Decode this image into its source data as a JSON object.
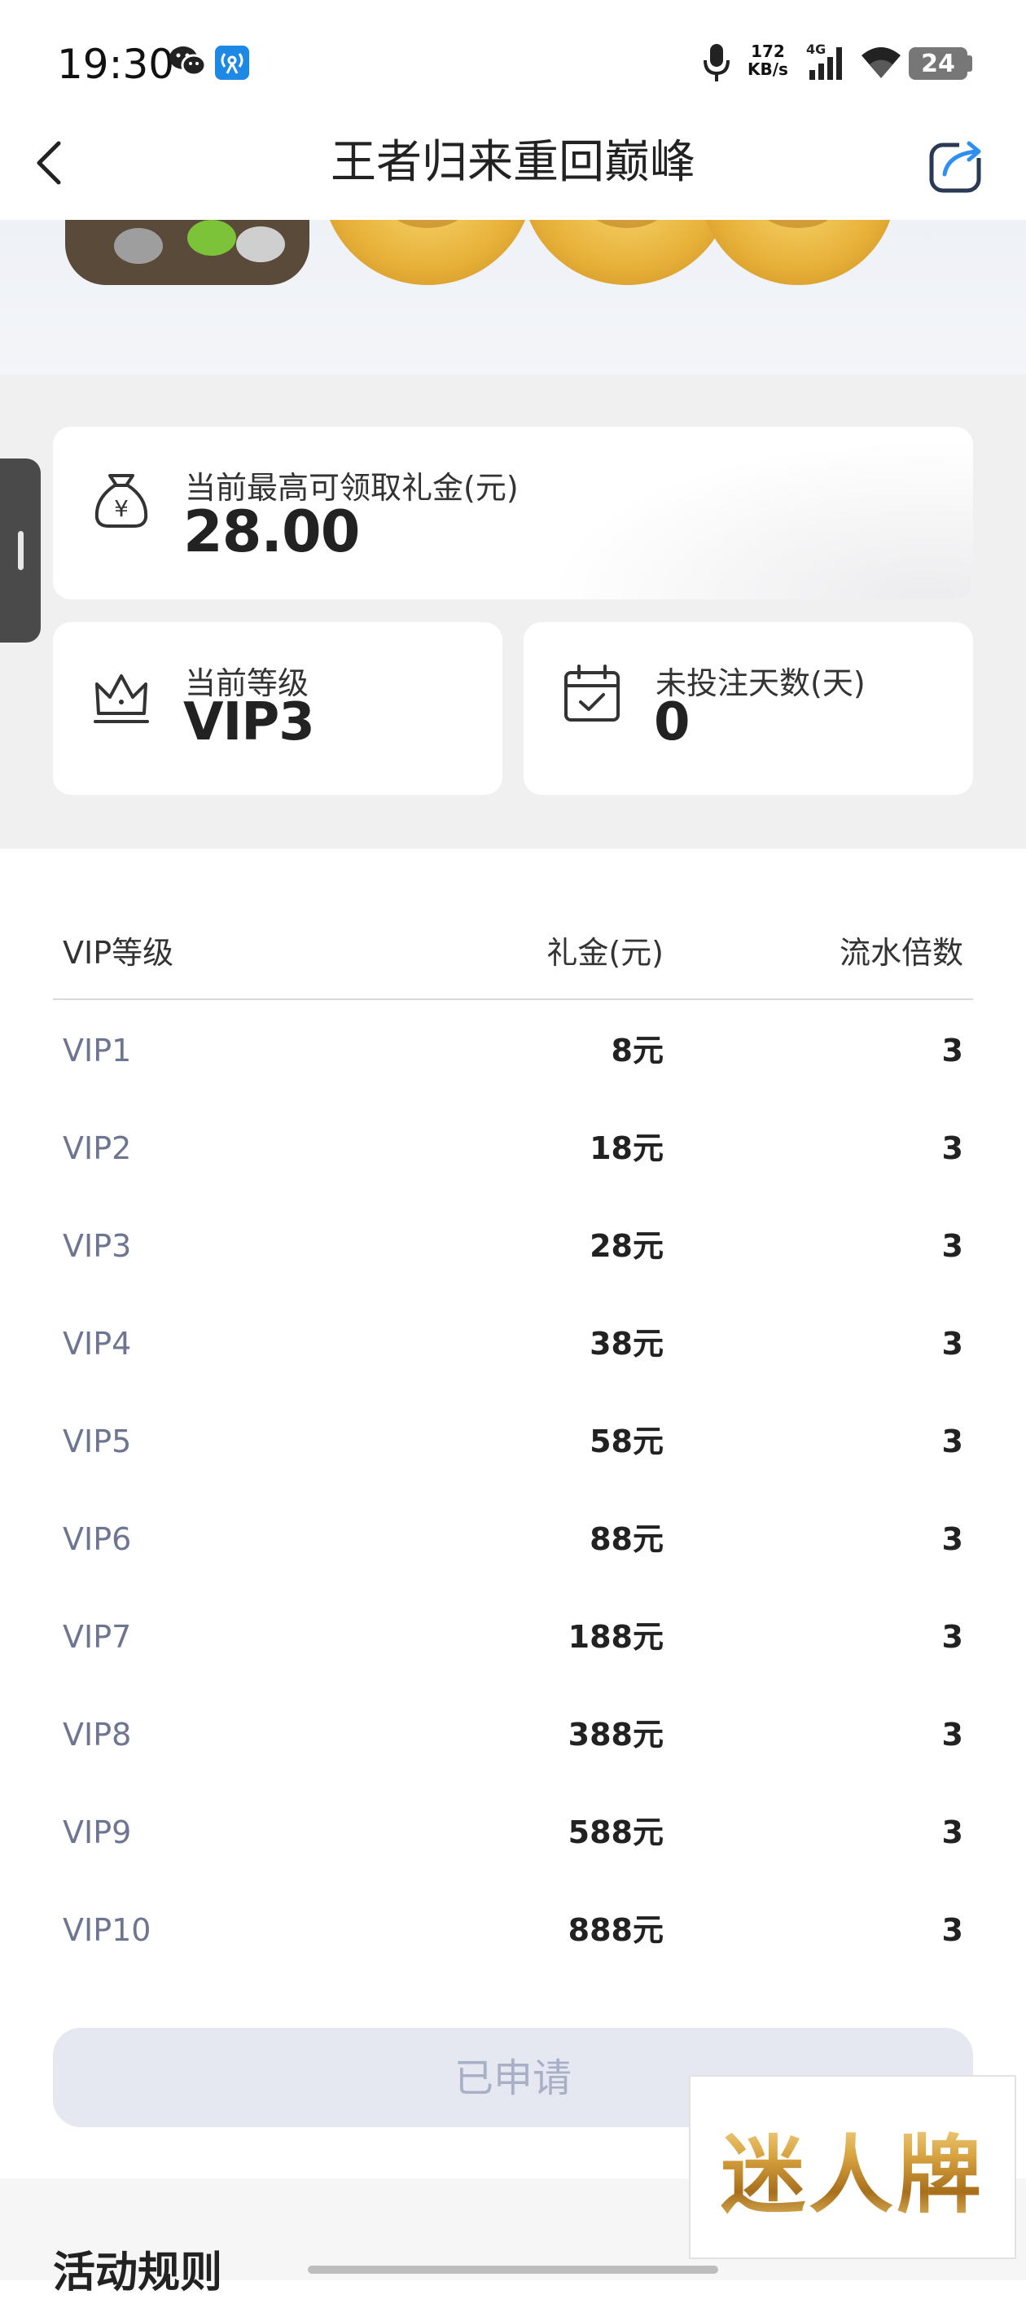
{
  "status_bar": {
    "time": "19:30",
    "net_speed_value": "172",
    "net_speed_unit": "KB/s",
    "network_type": "4G",
    "battery": "24",
    "icons": [
      "wechat-icon",
      "radio-app-icon",
      "mic-icon",
      "signal-icon",
      "wifi-icon",
      "battery-icon"
    ]
  },
  "header": {
    "title": "王者归来重回巅峰",
    "back_icon": "chevron-left-icon",
    "share_icon": "share-icon"
  },
  "summary": {
    "max_bonus_label": "当前最高可领取礼金(元)",
    "max_bonus_value": "28.00",
    "level_label": "当前等级",
    "level_value": "VIP3",
    "idle_days_label": "未投注天数(天)",
    "idle_days_value": "0"
  },
  "table": {
    "headers": [
      "VIP等级",
      "礼金(元)",
      "流水倍数"
    ],
    "rows": [
      {
        "level": "VIP1",
        "bonus": "8元",
        "multiplier": "3"
      },
      {
        "level": "VIP2",
        "bonus": "18元",
        "multiplier": "3"
      },
      {
        "level": "VIP3",
        "bonus": "28元",
        "multiplier": "3"
      },
      {
        "level": "VIP4",
        "bonus": "38元",
        "multiplier": "3"
      },
      {
        "level": "VIP5",
        "bonus": "58元",
        "multiplier": "3"
      },
      {
        "level": "VIP6",
        "bonus": "88元",
        "multiplier": "3"
      },
      {
        "level": "VIP7",
        "bonus": "188元",
        "multiplier": "3"
      },
      {
        "level": "VIP8",
        "bonus": "388元",
        "multiplier": "3"
      },
      {
        "level": "VIP9",
        "bonus": "588元",
        "multiplier": "3"
      },
      {
        "level": "VIP10",
        "bonus": "888元",
        "multiplier": "3"
      }
    ]
  },
  "apply_button": "已申请",
  "rules_title": "活动规则",
  "watermark": "迷人牌",
  "colors": {
    "accent_blue": "#1e88e5",
    "button_disabled_bg": "#e5e8f1",
    "button_disabled_text": "#a9b0c6",
    "level_text": "#6e7591",
    "gold": "#d9a441"
  }
}
